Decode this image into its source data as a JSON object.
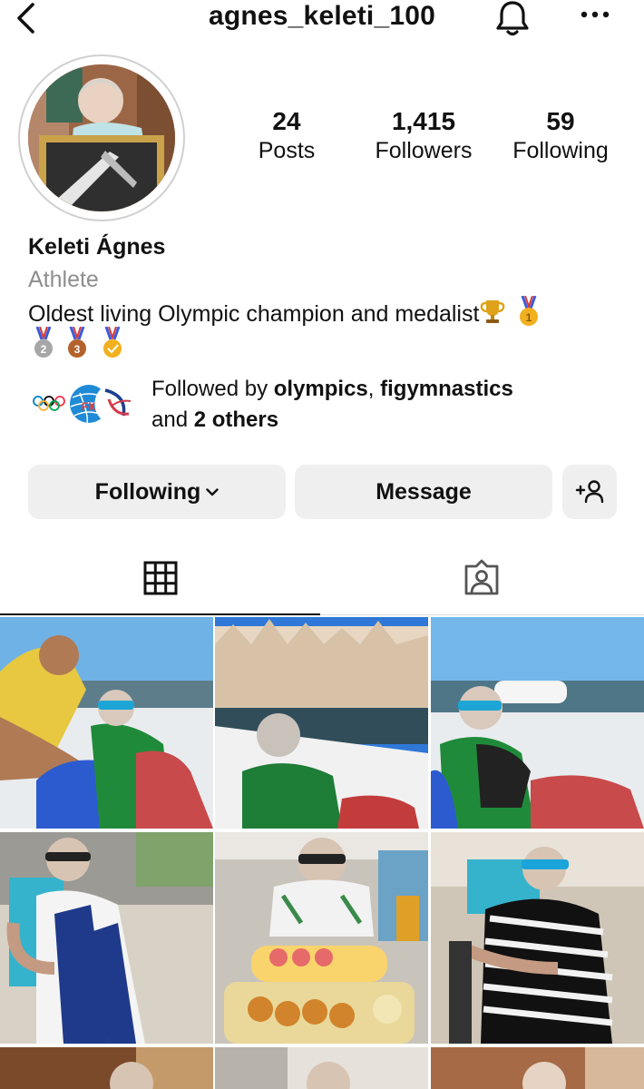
{
  "header": {
    "username": "agnes_keleti_100",
    "back_icon": "chevron-left-icon",
    "bell_icon": "bell-icon",
    "more_icon": "more-horizontal-icon"
  },
  "stats": [
    {
      "value": "24",
      "label": "Posts"
    },
    {
      "value": "1,415",
      "label": "Followers"
    },
    {
      "value": "59",
      "label": "Following"
    }
  ],
  "profile": {
    "name": "Keleti Ágnes",
    "category": "Athlete",
    "bio_line1": "Oldest living Olympic champion and medalist",
    "bio_emojis": [
      "trophy",
      "gold-medal-1",
      "silver-medal-2",
      "bronze-medal-3",
      "gold-medal"
    ]
  },
  "followed_by": {
    "prefix": "Followed by ",
    "user1": "olympics",
    "sep": ", ",
    "user2": "figymnastics",
    "line2_prefix": "and ",
    "others": "2 others"
  },
  "actions": {
    "following_label": "Following",
    "message_label": "Message",
    "add_person_icon": "add-person-icon"
  },
  "tabs": [
    {
      "icon": "grid-icon",
      "active": true
    },
    {
      "icon": "tagged-person-icon",
      "active": false
    }
  ],
  "colors": {
    "button_bg": "#efefef",
    "muted_text": "#8e8e8e",
    "text": "#111111"
  }
}
